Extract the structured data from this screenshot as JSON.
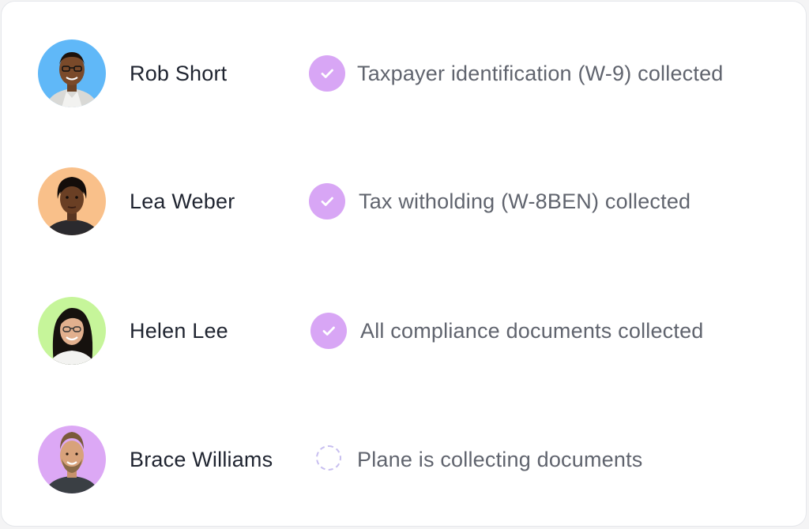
{
  "colors": {
    "check_bg": "#d8a6f5",
    "pending_ring": "#c8bff0",
    "name_text": "#1f2430",
    "status_text": "#60646e"
  },
  "people": [
    {
      "name": "Rob Short",
      "avatar_bg": "#60b8f8",
      "status_icon": "check-icon",
      "status": "Taxpayer identification (W-9) collected"
    },
    {
      "name": "Lea Weber",
      "avatar_bg": "#f9c08a",
      "status_icon": "check-icon",
      "status": "Tax witholding (W-8BEN) collected"
    },
    {
      "name": "Helen Lee",
      "avatar_bg": "#c6f59a",
      "status_icon": "check-icon",
      "status": "All compliance documents collected"
    },
    {
      "name": "Brace Williams",
      "avatar_bg": "#dca8f5",
      "status_icon": "pending-spinner-icon",
      "status": "Plane is collecting documents"
    }
  ]
}
